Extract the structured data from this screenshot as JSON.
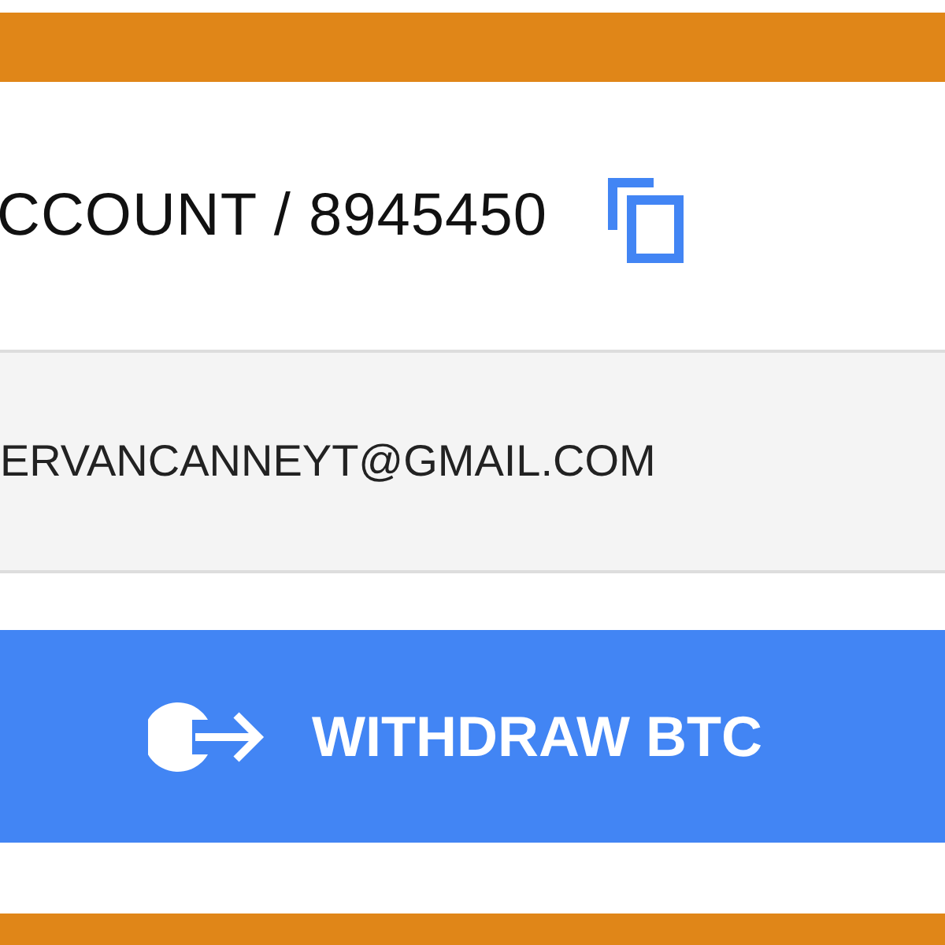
{
  "account": {
    "label": "CCOUNT / 8945450"
  },
  "email": {
    "value": "ERVANCANNEYT@GMAIL.COM"
  },
  "withdraw_button": {
    "label": "WITHDRAW BTC"
  }
}
